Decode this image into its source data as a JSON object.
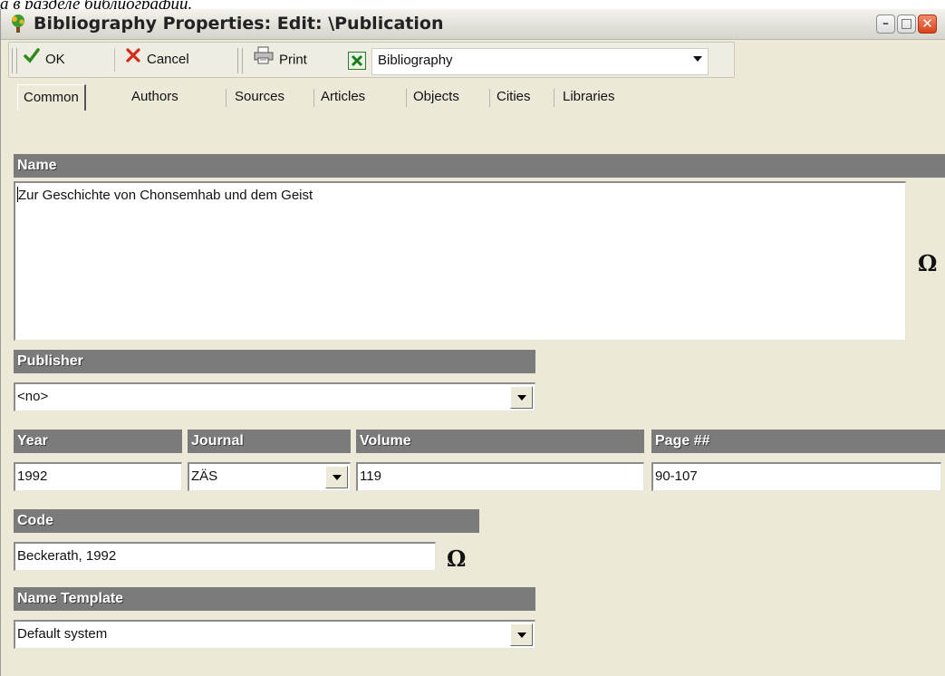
{
  "caption": "а в разделе библиографий.",
  "window": {
    "title": "Bibliography Properties: Edit: \\Publication",
    "controls": {
      "minimize": "–",
      "maximize": "□",
      "close": "✕"
    }
  },
  "toolbar": {
    "ok_label": "OK",
    "cancel_label": "Cancel",
    "print_label": "Print",
    "report_value": "Bibliography"
  },
  "tabs": [
    "Common",
    "Authors",
    "Sources",
    "Articles",
    "Objects",
    "Cities",
    "Libraries"
  ],
  "active_tab": "Common",
  "form": {
    "name_label": "Name",
    "name_value": "Zur Geschichte von Chonsemhab und dem Geist",
    "publisher_label": "Publisher",
    "publisher_value": "<no>",
    "year_label": "Year",
    "year_value": "1992",
    "journal_label": "Journal",
    "journal_value": "ZÄS",
    "volume_label": "Volume",
    "volume_value": "119",
    "pages_label": "Page ##",
    "pages_value": "90-107",
    "code_label": "Code",
    "code_value": "Beckerath, 1992",
    "template_label": "Name Template",
    "template_value": "Default system",
    "special_char_glyph": "Ω"
  },
  "colors": {
    "section_header": "#7b7b7b",
    "window_bg": "#ece9d8",
    "close_button": "#d8431a"
  },
  "icons": [
    "app-tree-icon",
    "ok-check-icon",
    "cancel-x-icon",
    "printer-icon",
    "excel-icon",
    "omega-icon",
    "dropdown-arrow-icon"
  ]
}
